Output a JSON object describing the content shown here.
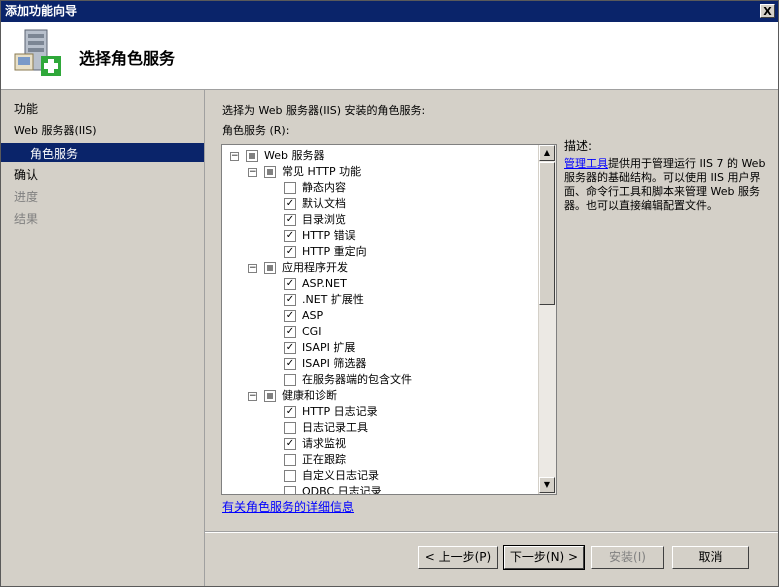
{
  "window": {
    "title": "添加功能向导",
    "close": "X"
  },
  "header": {
    "title": "选择角色服务"
  },
  "sidebar": {
    "items": [
      {
        "label": "功能",
        "dim": false
      },
      {
        "label": "Web 服务器(IIS)",
        "dim": false
      },
      {
        "label": "角色服务",
        "dim": false
      },
      {
        "label": "确认",
        "dim": false
      },
      {
        "label": "进度",
        "dim": true
      },
      {
        "label": "结果",
        "dim": true
      }
    ]
  },
  "main": {
    "instruction": "选择为 Web 服务器(IIS) 安装的角色服务:",
    "list_label": "角色服务 (R):",
    "tree": [
      {
        "label": "Web 服务器",
        "level": 0,
        "state": "partial",
        "expandable": true
      },
      {
        "label": "常见 HTTP 功能",
        "level": 1,
        "state": "partial",
        "expandable": true
      },
      {
        "label": "静态内容",
        "level": 2,
        "state": "unchecked",
        "expandable": false
      },
      {
        "label": "默认文档",
        "level": 2,
        "state": "checked",
        "expandable": false
      },
      {
        "label": "目录浏览",
        "level": 2,
        "state": "checked",
        "expandable": false
      },
      {
        "label": "HTTP 错误",
        "level": 2,
        "state": "checked",
        "expandable": false
      },
      {
        "label": "HTTP 重定向",
        "level": 2,
        "state": "checked",
        "expandable": false
      },
      {
        "label": "应用程序开发",
        "level": 1,
        "state": "partial",
        "expandable": true
      },
      {
        "label": "ASP.NET",
        "level": 2,
        "state": "checked",
        "expandable": false
      },
      {
        "label": ".NET 扩展性",
        "level": 2,
        "state": "checked",
        "expandable": false
      },
      {
        "label": "ASP",
        "level": 2,
        "state": "checked",
        "expandable": false
      },
      {
        "label": "CGI",
        "level": 2,
        "state": "checked",
        "expandable": false
      },
      {
        "label": "ISAPI 扩展",
        "level": 2,
        "state": "checked",
        "expandable": false
      },
      {
        "label": "ISAPI 筛选器",
        "level": 2,
        "state": "checked",
        "expandable": false
      },
      {
        "label": "在服务器端的包含文件",
        "level": 2,
        "state": "unchecked",
        "expandable": false
      },
      {
        "label": "健康和诊断",
        "level": 1,
        "state": "partial",
        "expandable": true
      },
      {
        "label": "HTTP 日志记录",
        "level": 2,
        "state": "checked",
        "expandable": false
      },
      {
        "label": "日志记录工具",
        "level": 2,
        "state": "unchecked",
        "expandable": false
      },
      {
        "label": "请求监视",
        "level": 2,
        "state": "checked",
        "expandable": false
      },
      {
        "label": "正在跟踪",
        "level": 2,
        "state": "unchecked",
        "expandable": false
      },
      {
        "label": "自定义日志记录",
        "level": 2,
        "state": "unchecked",
        "expandable": false
      },
      {
        "label": "ODBC 日志记录",
        "level": 2,
        "state": "unchecked",
        "expandable": false
      }
    ],
    "description_title": "描述:",
    "description_link": "管理工具",
    "description_text": "提供用于管理运行 IIS 7 的 Web 服务器的基础结构。可以使用 IIS 用户界面、命令行工具和脚本来管理 Web 服务器。也可以直接编辑配置文件。",
    "more_info_link": "有关角色服务的详细信息"
  },
  "buttons": {
    "back": "< 上一步(P)",
    "next": "下一步(N) >",
    "install": "安装(I)",
    "cancel": "取消"
  },
  "icons": {
    "header": "server-add-icon",
    "check": "✓",
    "collapse": "−",
    "scroll_up": "▲",
    "scroll_down": "▼"
  }
}
